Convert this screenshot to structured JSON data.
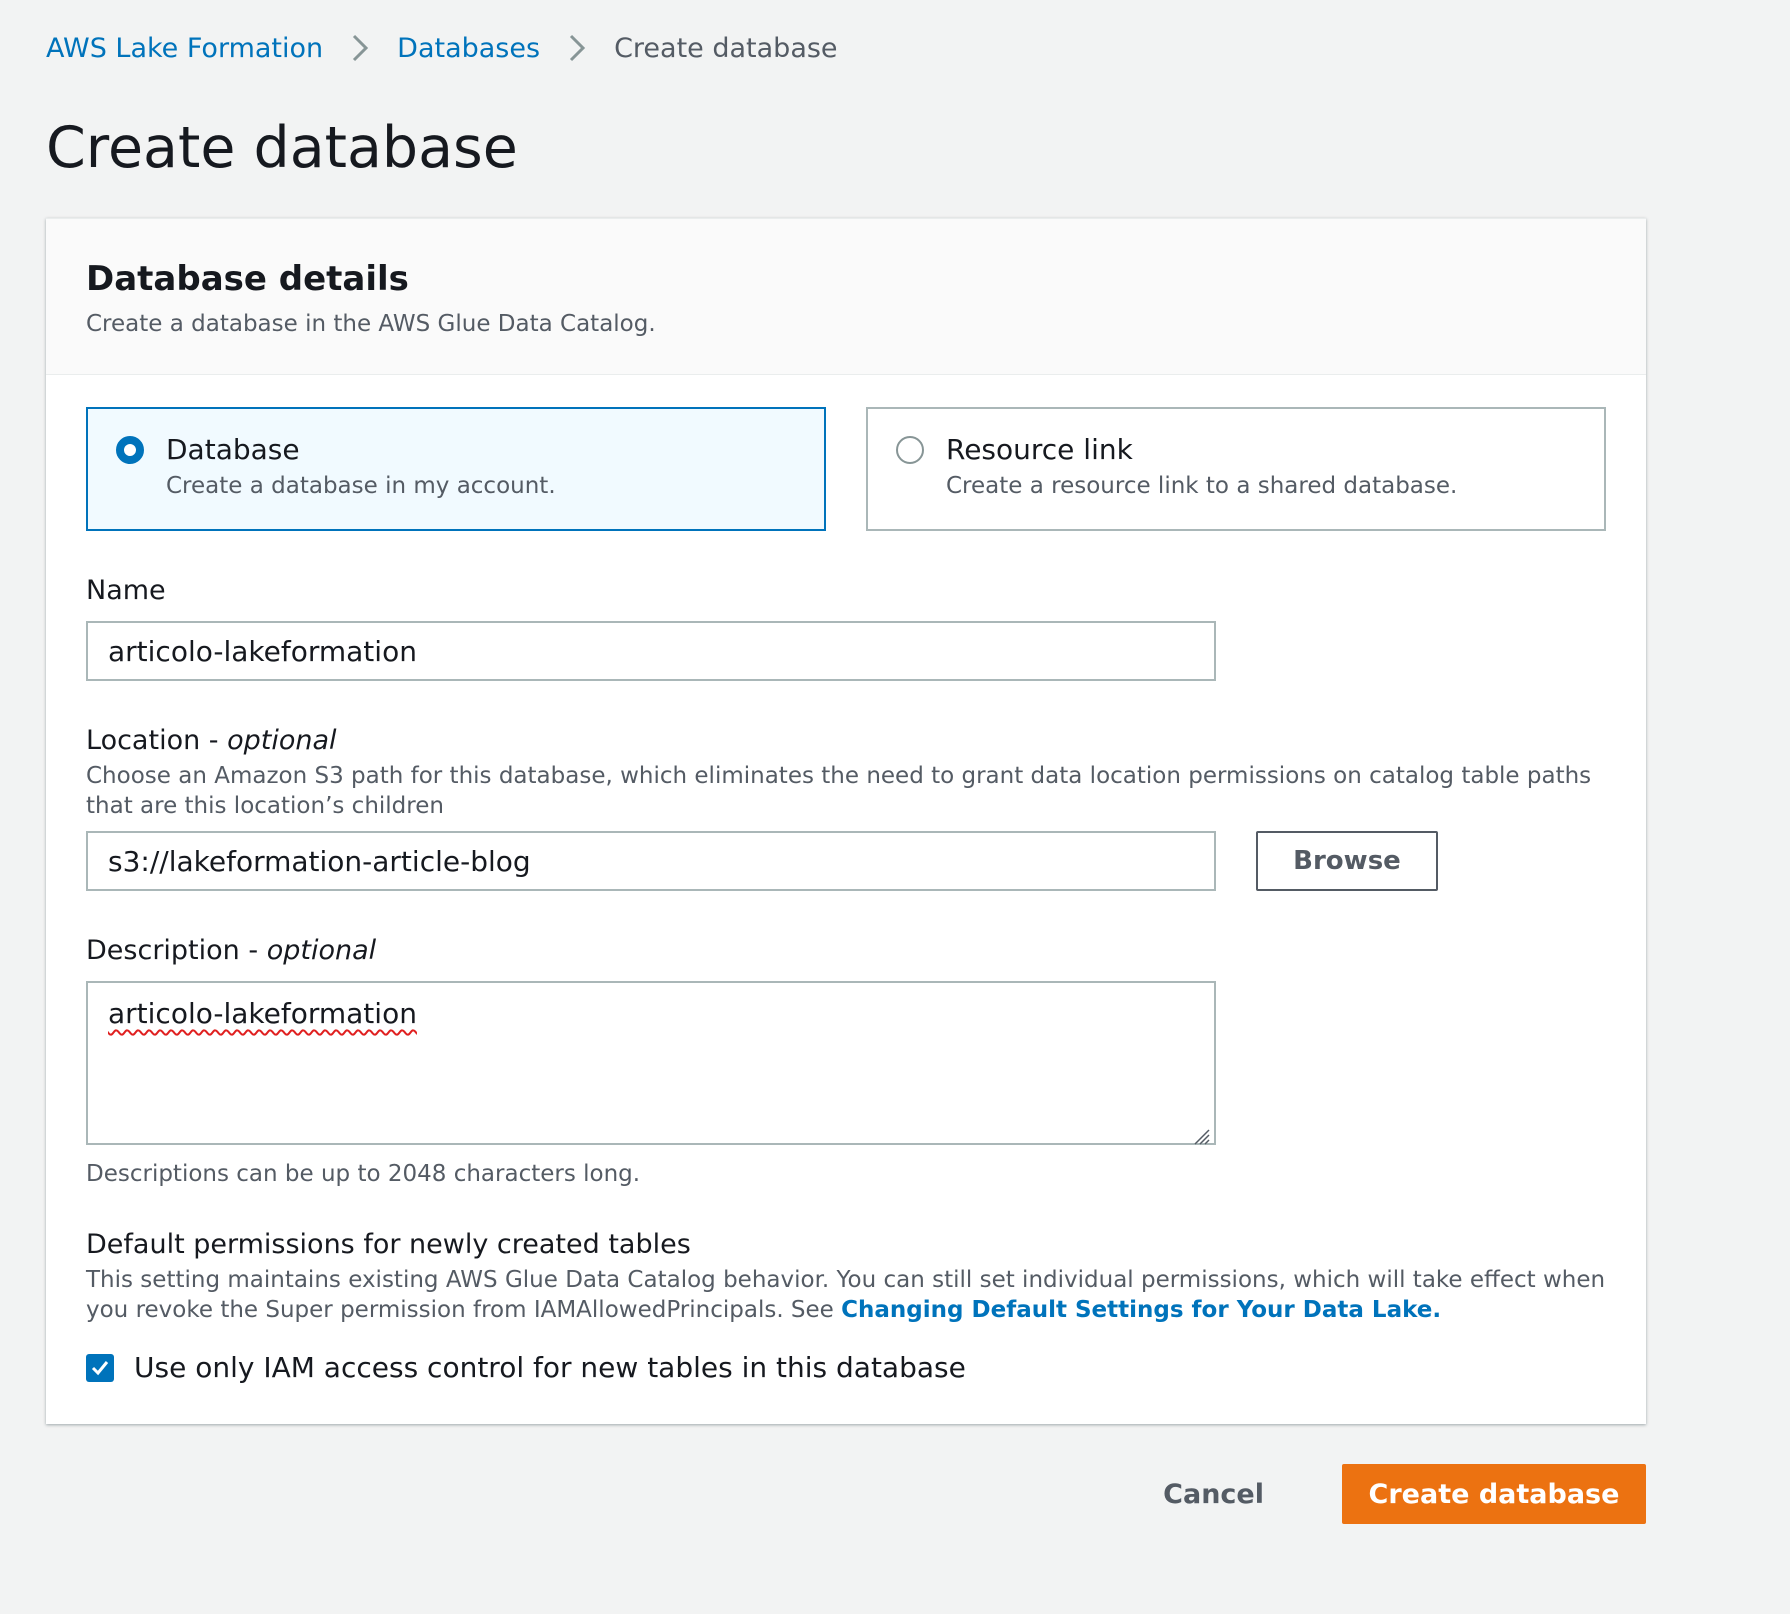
{
  "breadcrumb": {
    "items": [
      {
        "label": "AWS Lake Formation"
      },
      {
        "label": "Databases"
      },
      {
        "label": "Create database"
      }
    ]
  },
  "page": {
    "title": "Create database"
  },
  "panel": {
    "title": "Database details",
    "description": "Create a database in the AWS Glue Data Catalog."
  },
  "tiles": [
    {
      "label": "Database",
      "description": "Create a database in my account.",
      "selected": true
    },
    {
      "label": "Resource link",
      "description": "Create a resource link to a shared database.",
      "selected": false
    }
  ],
  "name_field": {
    "label": "Name",
    "value": "articolo-lakeformation"
  },
  "location_field": {
    "label": "Location",
    "optional": "optional",
    "separator": " - ",
    "help": "Choose an Amazon S3 path for this database, which eliminates the need to grant data location permissions on catalog table paths that are this location’s children",
    "value": "s3://lakeformation-article-blog",
    "browse_label": "Browse"
  },
  "description_field": {
    "label": "Description",
    "optional": "optional",
    "separator": " - ",
    "value": "articolo-lakeformation",
    "help": "Descriptions can be up to 2048 characters long."
  },
  "default_permissions": {
    "title": "Default permissions for newly created tables",
    "help": "This setting maintains existing AWS Glue Data Catalog behavior. You can still set individual permissions, which will take effect when you revoke the Super permission from IAMAllowedPrincipals. See ",
    "link": "Changing Default Settings for Your Data Lake.",
    "checkbox_label": "Use only IAM access control for new tables in this database",
    "checked": true
  },
  "footer": {
    "cancel_label": "Cancel",
    "submit_label": "Create database"
  },
  "colors": {
    "link": "#0073bb",
    "primary": "#ec7211",
    "selected_tile_bg": "#f1faff",
    "page_bg": "#f2f3f3"
  }
}
